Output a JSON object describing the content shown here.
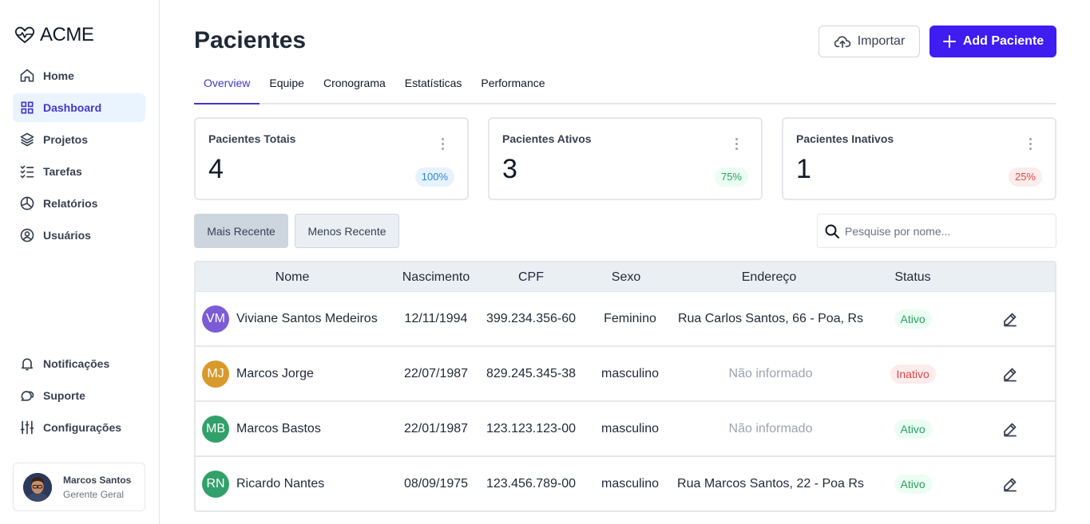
{
  "app": {
    "logo_text": "ACME"
  },
  "sidebar": {
    "items": [
      {
        "label": "Home",
        "icon": "home-icon"
      },
      {
        "label": "Dashboard",
        "icon": "grid-icon",
        "active": true
      },
      {
        "label": "Projetos",
        "icon": "layers-icon"
      },
      {
        "label": "Tarefas",
        "icon": "checklist-icon"
      },
      {
        "label": "Relatórios",
        "icon": "pie-chart-icon"
      },
      {
        "label": "Usuários",
        "icon": "user-circle-icon"
      }
    ],
    "bottom_items": [
      {
        "label": "Notificações",
        "icon": "bell-icon"
      },
      {
        "label": "Suporte",
        "icon": "chat-icon"
      },
      {
        "label": "Configurações",
        "icon": "sliders-icon"
      }
    ],
    "profile": {
      "name": "Marcos Santos",
      "role": "Gerente Geral"
    }
  },
  "header": {
    "title": "Pacientes",
    "import_label": "Importar",
    "add_label": "Add Paciente"
  },
  "tabs": [
    {
      "label": "Overview",
      "active": true
    },
    {
      "label": "Equipe"
    },
    {
      "label": "Cronograma"
    },
    {
      "label": "Estatísticas"
    },
    {
      "label": "Performance"
    }
  ],
  "cards": [
    {
      "title": "Pacientes Totais",
      "value": "4",
      "badge": "100%",
      "badge_color": "#2f86d6",
      "badge_bg": "#e6f2fd"
    },
    {
      "title": "Pacientes Ativos",
      "value": "3",
      "badge": "75%",
      "badge_color": "#22a45d",
      "badge_bg": "#ecfdf3"
    },
    {
      "title": "Pacientes Inativos",
      "value": "1",
      "badge": "25%",
      "badge_color": "#e0474b",
      "badge_bg": "#fdecec"
    }
  ],
  "filters": {
    "most_recent": "Mais Recente",
    "least_recent": "Menos Recente",
    "search_placeholder": "Pesquise por nome..."
  },
  "table": {
    "columns": [
      "Nome",
      "Nascimento",
      "CPF",
      "Sexo",
      "Endereço",
      "Status"
    ],
    "rows": [
      {
        "initials": "VM",
        "avatar_color": "#7b5bd6",
        "name": "Viviane Santos Medeiros",
        "birth": "12/11/1994",
        "cpf": "399.234.356-60",
        "sex": "Feminino",
        "address": "Rua Carlos Santos, 66 - Poa, Rs",
        "address_muted": false,
        "status": "Ativo",
        "active": true
      },
      {
        "initials": "MJ",
        "avatar_color": "#d99a2b",
        "name": "Marcos Jorge",
        "birth": "22/07/1987",
        "cpf": "829.245.345-38",
        "sex": "masculino",
        "address": "Não informado",
        "address_muted": true,
        "status": "Inativo",
        "active": false
      },
      {
        "initials": "MB",
        "avatar_color": "#32a06a",
        "name": "Marcos Bastos",
        "birth": "22/01/1987",
        "cpf": "123.123.123-00",
        "sex": "masculino",
        "address": "Não informado",
        "address_muted": true,
        "status": "Ativo",
        "active": true
      },
      {
        "initials": "RN",
        "avatar_color": "#32a06a",
        "name": "Ricardo Nantes",
        "birth": "08/09/1975",
        "cpf": "123.456.789-00",
        "sex": "masculino",
        "address": "Rua Marcos Santos, 22 - Poa Rs",
        "address_muted": false,
        "status": "Ativo",
        "active": true
      }
    ]
  }
}
